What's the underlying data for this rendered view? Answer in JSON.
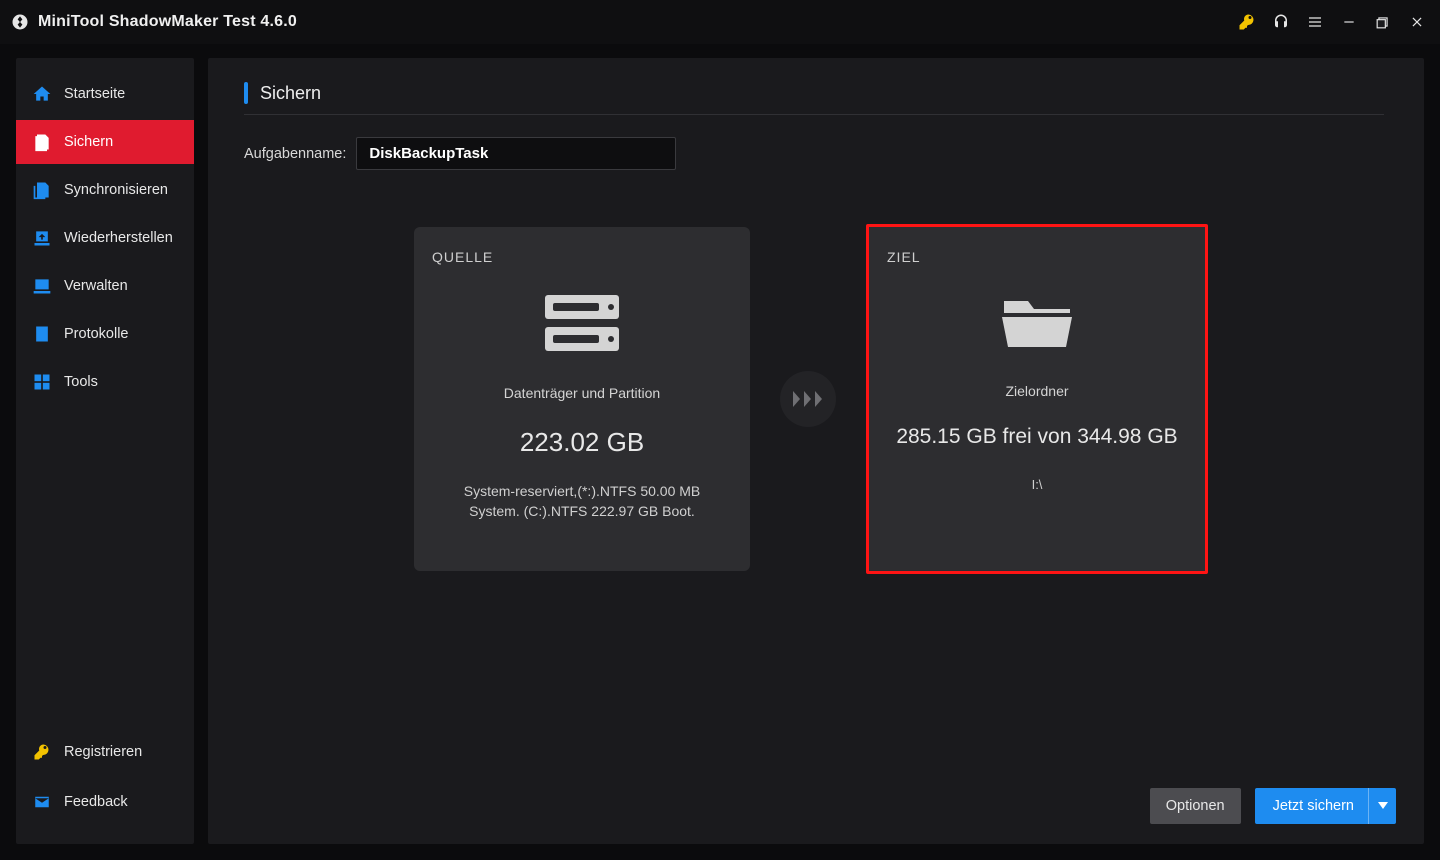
{
  "app": {
    "title": "MiniTool ShadowMaker Test 4.6.0"
  },
  "sidebar": {
    "items": [
      {
        "label": "Startseite"
      },
      {
        "label": "Sichern"
      },
      {
        "label": "Synchronisieren"
      },
      {
        "label": "Wiederherstellen"
      },
      {
        "label": "Verwalten"
      },
      {
        "label": "Protokolle"
      },
      {
        "label": "Tools"
      }
    ],
    "register": "Registrieren",
    "feedback": "Feedback"
  },
  "page": {
    "title": "Sichern",
    "task_name_label": "Aufgabenname:",
    "task_name_value": "DiskBackupTask"
  },
  "source_card": {
    "title": "QUELLE",
    "subtitle": "Datenträger und Partition",
    "size": "223.02 GB",
    "detail": "System-reserviert,(*:).NTFS 50.00 MB System. (C:).NTFS 222.97 GB Boot."
  },
  "dest_card": {
    "title": "ZIEL",
    "subtitle": "Zielordner",
    "space": "285.15 GB frei von 344.98 GB",
    "path": "I:\\"
  },
  "footer": {
    "options": "Optionen",
    "backup_now": "Jetzt sichern"
  }
}
